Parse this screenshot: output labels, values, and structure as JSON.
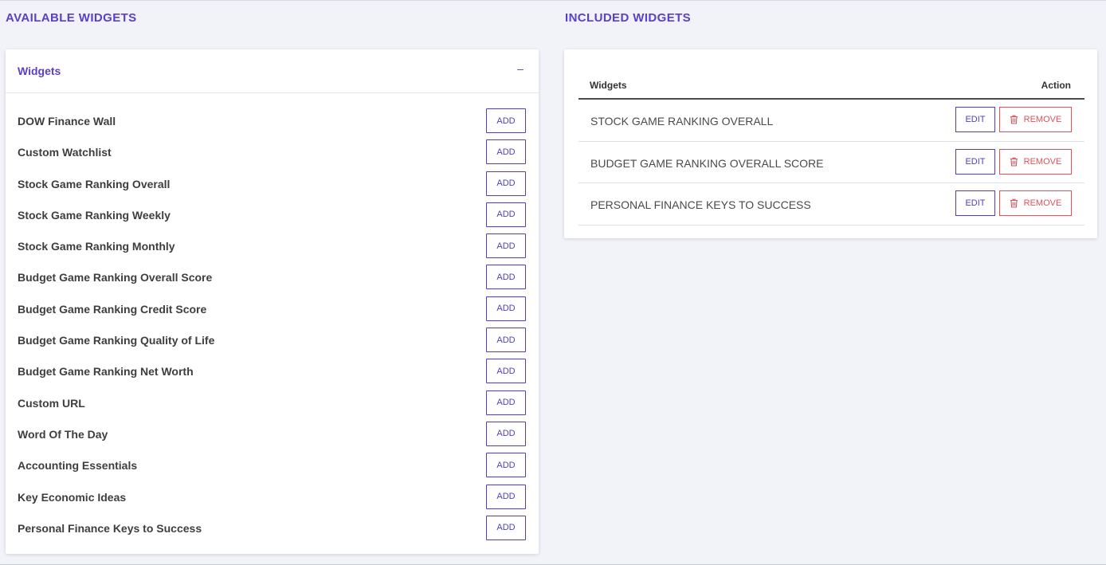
{
  "available": {
    "section_title": "AVAILABLE WIDGETS",
    "card_title": "Widgets",
    "collapse_label": "–",
    "add_label": "ADD",
    "items": [
      "DOW Finance Wall",
      "Custom Watchlist",
      "Stock Game Ranking Overall",
      "Stock Game Ranking Weekly",
      "Stock Game Ranking Monthly",
      "Budget Game Ranking Overall Score",
      "Budget Game Ranking Credit Score",
      "Budget Game Ranking Quality of Life",
      "Budget Game Ranking Net Worth",
      "Custom URL",
      "Word Of The Day",
      "Accounting Essentials",
      "Key Economic Ideas",
      "Personal Finance Keys to Success"
    ]
  },
  "included": {
    "section_title": "INCLUDED WIDGETS",
    "col_widgets": "Widgets",
    "col_action": "Action",
    "edit_label": "EDIT",
    "remove_label": "REMOVE",
    "rows": [
      "STOCK GAME RANKING OVERALL",
      "BUDGET GAME RANKING OVERALL SCORE",
      "PERSONAL FINANCE KEYS TO SUCCESS"
    ]
  },
  "colors": {
    "accent": "#5b3fc8",
    "button_border": "#4d3fbf",
    "danger": "#e0525a",
    "background": "#f1f3f9"
  },
  "icons": {
    "collapse": "minus-icon",
    "remove": "trash-icon"
  }
}
